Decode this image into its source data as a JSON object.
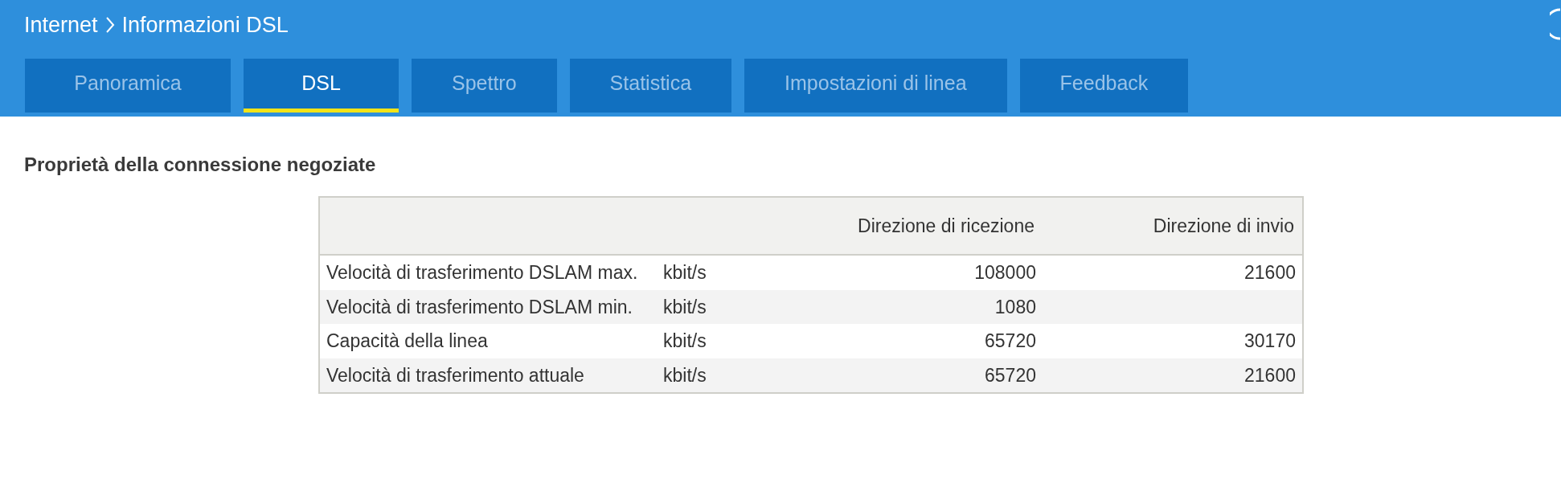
{
  "breadcrumb": [
    "Internet",
    "Informazioni DSL"
  ],
  "tabs": [
    {
      "label": "Panoramica",
      "selected": false
    },
    {
      "label": "DSL",
      "selected": true
    },
    {
      "label": "Spettro",
      "selected": false
    },
    {
      "label": "Statistica",
      "selected": false
    },
    {
      "label": "Impostazioni di linea",
      "selected": false
    },
    {
      "label": "Feedback",
      "selected": false
    }
  ],
  "section_title": "Proprietà della connessione negoziate",
  "table": {
    "columns": [
      "",
      "",
      "Direzione di ricezione",
      "Direzione di invio"
    ],
    "rows": [
      [
        "Velocità di trasferimento DSLAM max.",
        "kbit/s",
        "108000",
        "21600"
      ],
      [
        "Velocità di trasferimento DSLAM min.",
        "kbit/s",
        "1080",
        ""
      ],
      [
        "Capacità della linea",
        "kbit/s",
        "65720",
        "30170"
      ],
      [
        "Velocità di trasferimento attuale",
        "kbit/s",
        "65720",
        "21600"
      ]
    ]
  }
}
